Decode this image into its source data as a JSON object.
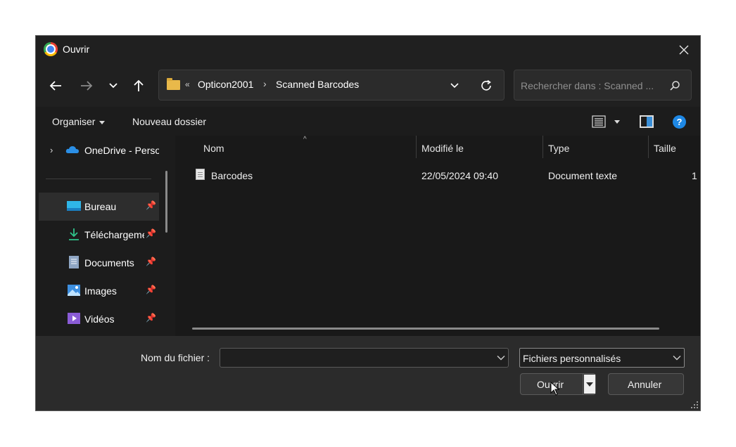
{
  "window": {
    "title": "Ouvrir",
    "app_icon": "chrome-icon"
  },
  "nav": {
    "back_icon": "arrow-left-icon",
    "forward_icon": "arrow-right-icon",
    "recent_icon": "chevron-down-icon",
    "up_icon": "arrow-up-icon",
    "breadcrumb_overflow": "«",
    "breadcrumbs": [
      "Opticon2001",
      "Scanned Barcodes"
    ],
    "breadcrumb_separator": "›",
    "search_placeholder": "Rechercher dans : Scanned ..."
  },
  "commandbar": {
    "organize_label": "Organiser",
    "new_folder_label": "Nouveau dossier",
    "help_label": "?"
  },
  "sidebar": {
    "items": [
      {
        "label": "OneDrive - Personnel",
        "icon": "onedrive-cloud-icon",
        "pinned": false
      },
      {
        "label": "Bureau",
        "icon": "desktop-icon",
        "pinned": true
      },
      {
        "label": "Téléchargements",
        "icon": "download-icon",
        "pinned": true
      },
      {
        "label": "Documents",
        "icon": "documents-icon",
        "pinned": true
      },
      {
        "label": "Images",
        "icon": "images-icon",
        "pinned": true
      },
      {
        "label": "Vidéos",
        "icon": "videos-icon",
        "pinned": true
      }
    ]
  },
  "filelist": {
    "columns": [
      "Nom",
      "Modifié le",
      "Type",
      "Taille"
    ],
    "rows": [
      {
        "name": "Barcodes",
        "modified": "22/05/2024 09:40",
        "type": "Document texte",
        "size": "1"
      }
    ]
  },
  "footer": {
    "filename_label": "Nom du fichier :",
    "filename_value": "",
    "filter_value": "Fichiers personnalisés",
    "open_label": "Ouvrir",
    "cancel_label": "Annuler"
  },
  "colors": {
    "background": "#202020",
    "accent": "#1e88e5",
    "folder": "#e9b94a"
  }
}
